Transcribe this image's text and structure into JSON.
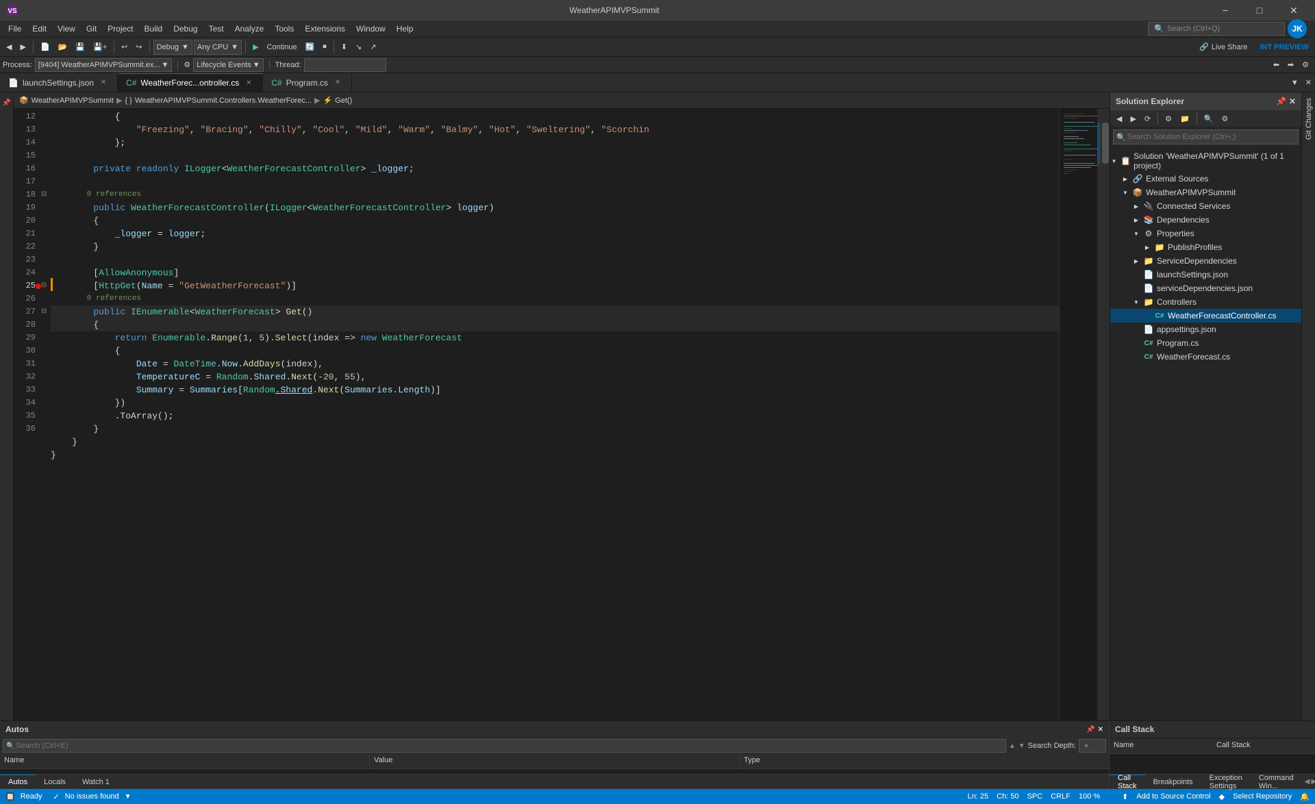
{
  "titlebar": {
    "logo": "VS",
    "title": "WeatherAPIMVPSummit",
    "user_icon": "JK",
    "minimize": "−",
    "maximize": "□",
    "close": "✕"
  },
  "menu": {
    "items": [
      "File",
      "Edit",
      "View",
      "Git",
      "Project",
      "Build",
      "Debug",
      "Test",
      "Analyze",
      "Tools",
      "Extensions",
      "Window",
      "Help"
    ]
  },
  "toolbar": {
    "debug_mode": "Debug",
    "platform": "Any CPU",
    "continue": "Continue",
    "live_share": "Live Share",
    "int_preview": "INT PREVIEW",
    "search_placeholder": "Search (Ctrl+Q)"
  },
  "process_bar": {
    "process_label": "Process:",
    "process_value": "[9404] WeatherAPIMVPSummit.ex...",
    "lifecycle_label": "Lifecycle Events",
    "thread_label": "Thread:"
  },
  "tabs": {
    "items": [
      {
        "label": "launchSettings.json",
        "active": false
      },
      {
        "label": "WeatherForec...ontroller.cs",
        "active": true
      },
      {
        "label": "Program.cs",
        "active": false
      }
    ]
  },
  "breadcrumb": {
    "project": "WeatherAPIMVPSummit",
    "namespace": "WeatherAPIMVPSummit.Controllers.WeatherForec...",
    "member": "Get()"
  },
  "code": {
    "lines": [
      {
        "num": 12,
        "content": "            {",
        "collapse": false
      },
      {
        "num": 13,
        "content": "                \"Freezing\", \"Bracing\", \"Chilly\", \"Cool\", \"Mild\", \"Warm\", \"Balmy\", \"Hot\", \"Sweltering\", \"Scorchin",
        "collapse": false
      },
      {
        "num": 14,
        "content": "            };",
        "collapse": false
      },
      {
        "num": 15,
        "content": "",
        "collapse": false
      },
      {
        "num": 16,
        "content": "        private readonly ILogger<WeatherForecastController> _logger;",
        "collapse": false
      },
      {
        "num": 17,
        "content": "",
        "collapse": false
      },
      {
        "num": 18,
        "content": "        public WeatherForecastController(ILogger<WeatherForecastController> logger)",
        "ref": "0 references",
        "collapse": true
      },
      {
        "num": 19,
        "content": "        {",
        "collapse": false
      },
      {
        "num": 20,
        "content": "            _logger = logger;",
        "collapse": false
      },
      {
        "num": 21,
        "content": "        }",
        "collapse": false
      },
      {
        "num": 22,
        "content": "",
        "collapse": false
      },
      {
        "num": 23,
        "content": "        [AllowAnonymous]",
        "collapse": false
      },
      {
        "num": 24,
        "content": "        [HttpGet(Name = \"GetWeatherForecast\")]",
        "collapse": false
      },
      {
        "num": 25,
        "content": "        public IEnumerable<WeatherForecast> Get()",
        "ref": "0 references",
        "collapse": true,
        "current": true,
        "debug": true
      },
      {
        "num": 26,
        "content": "        {",
        "collapse": false
      },
      {
        "num": 27,
        "content": "            return Enumerable.Range(1, 5).Select(index => new WeatherForecast",
        "collapse": true
      },
      {
        "num": 28,
        "content": "            {",
        "collapse": false
      },
      {
        "num": 29,
        "content": "                Date = DateTime.Now.AddDays(index),",
        "collapse": false
      },
      {
        "num": 30,
        "content": "                TemperatureC = Random.Shared.Next(-20, 55),",
        "collapse": false
      },
      {
        "num": 31,
        "content": "                Summary = Summaries[Random.Shared.Next(Summaries.Length)]",
        "collapse": false
      },
      {
        "num": 32,
        "content": "            })",
        "collapse": false
      },
      {
        "num": 33,
        "content": "            .ToArray();",
        "collapse": false
      },
      {
        "num": 34,
        "content": "        }",
        "collapse": false
      },
      {
        "num": 35,
        "content": "    }",
        "collapse": false
      },
      {
        "num": 36,
        "content": "}",
        "collapse": false
      }
    ]
  },
  "status_bar_editor": {
    "issues": "No issues found",
    "line": "Ln: 25",
    "col": "Ch: 50",
    "encoding": "SPC",
    "line_ending": "CRLF",
    "zoom": "100 %"
  },
  "solution_explorer": {
    "title": "Solution Explorer",
    "search_placeholder": "Search Solution Explorer (Ctrl+;)",
    "tree": [
      {
        "level": 0,
        "label": "Solution 'WeatherAPIMVPSummit' (1 of 1 project)",
        "icon": "📋",
        "expanded": true,
        "arrow": "down"
      },
      {
        "level": 1,
        "label": "External Sources",
        "icon": "🔗",
        "expanded": false,
        "arrow": "right"
      },
      {
        "level": 1,
        "label": "WeatherAPIMVPSummit",
        "icon": "📦",
        "expanded": true,
        "arrow": "down"
      },
      {
        "level": 2,
        "label": "Connected Services",
        "icon": "🔌",
        "expanded": false,
        "arrow": "right"
      },
      {
        "level": 2,
        "label": "Dependencies",
        "icon": "📚",
        "expanded": false,
        "arrow": "right"
      },
      {
        "level": 2,
        "label": "Properties",
        "icon": "⚙",
        "expanded": true,
        "arrow": "down"
      },
      {
        "level": 3,
        "label": "PublishProfiles",
        "icon": "📁",
        "expanded": false,
        "arrow": "right"
      },
      {
        "level": 2,
        "label": "ServiceDependencies",
        "icon": "📁",
        "expanded": false,
        "arrow": "right"
      },
      {
        "level": 2,
        "label": "launchSettings.json",
        "icon": "📄",
        "expanded": false,
        "arrow": ""
      },
      {
        "level": 2,
        "label": "serviceDependencies.json",
        "icon": "📄",
        "expanded": false,
        "arrow": ""
      },
      {
        "level": 2,
        "label": "Controllers",
        "icon": "📁",
        "expanded": true,
        "arrow": "down"
      },
      {
        "level": 3,
        "label": "WeatherForecastController.cs",
        "icon": "C#",
        "expanded": false,
        "arrow": "",
        "selected": true
      },
      {
        "level": 2,
        "label": "appsettings.json",
        "icon": "📄",
        "expanded": false,
        "arrow": ""
      },
      {
        "level": 2,
        "label": "Program.cs",
        "icon": "C#",
        "expanded": false,
        "arrow": ""
      },
      {
        "level": 2,
        "label": "WeatherForecast.cs",
        "icon": "C#",
        "expanded": false,
        "arrow": ""
      }
    ]
  },
  "bottom_panel": {
    "autos_title": "Autos",
    "search_placeholder": "Search (Ctrl+E)",
    "search_depth_label": "Search Depth:",
    "col_name": "Name",
    "col_value": "Value",
    "col_type": "Type",
    "tabs": [
      "Autos",
      "Locals",
      "Watch 1"
    ],
    "active_tab": "Autos"
  },
  "call_stack": {
    "title": "Call Stack",
    "col_name": "Name",
    "col_call_stack": "Call Stack",
    "tabs": [
      "Call Stack",
      "Breakpoints",
      "Exception Settings",
      "Command Win..."
    ],
    "active_tab": "Call Stack"
  },
  "status_bar": {
    "ready": "Ready",
    "source_control": "Add to Source Control",
    "select_repo": "Select Repository",
    "bell": "🔔"
  }
}
